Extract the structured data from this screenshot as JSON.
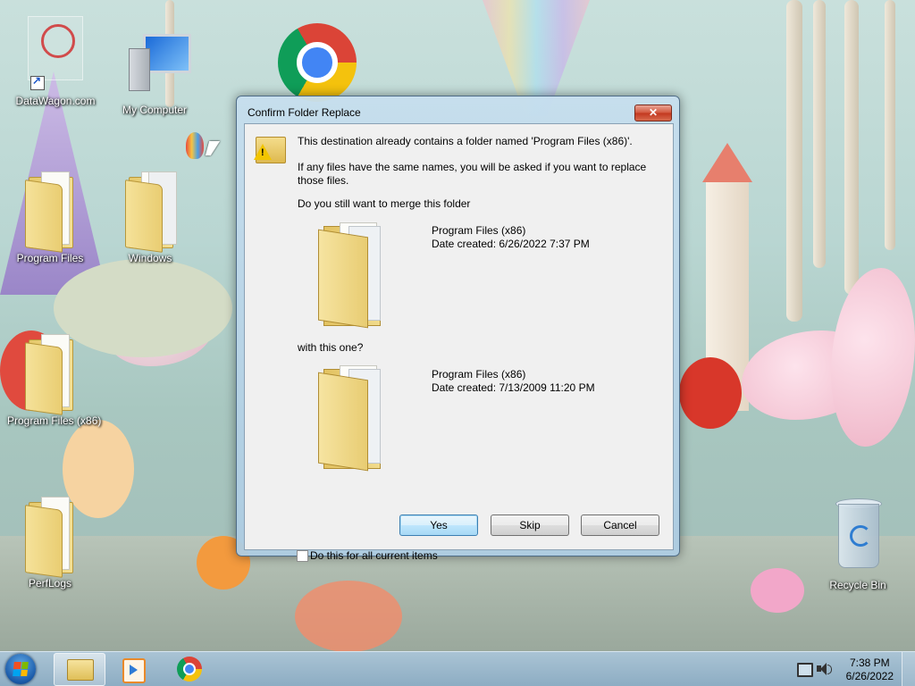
{
  "desktop": {
    "icons": [
      {
        "label": "DataWagon.com"
      },
      {
        "label": "My Computer"
      },
      {
        "label": "Program Files"
      },
      {
        "label": "Windows"
      },
      {
        "label": "Program Files (x86)"
      },
      {
        "label": "PerfLogs"
      },
      {
        "label": "Recycle Bin"
      }
    ]
  },
  "dialog": {
    "title": "Confirm Folder Replace",
    "close_glyph": "✕",
    "message": "This destination already contains a folder named 'Program Files (x86)'.",
    "detail": "If any files have the same names, you will be asked if you want to replace those files.",
    "question": "Do you still want to merge this folder",
    "source": {
      "name": "Program Files (x86)",
      "date": "Date created: 6/26/2022 7:37 PM"
    },
    "with_label": "with this one?",
    "target": {
      "name": "Program Files (x86)",
      "date": "Date created: 7/13/2009 11:20 PM"
    },
    "buttons": {
      "yes": "Yes",
      "skip": "Skip",
      "cancel": "Cancel"
    },
    "checkbox_label": "Do this for all current items",
    "checkbox_checked": false
  },
  "taskbar": {
    "pinned": [
      "folder-icon",
      "media-player-icon",
      "chrome-icon"
    ],
    "time": "7:38 PM",
    "date": "6/26/2022",
    "tray_icons": [
      "network-icon",
      "volume-icon"
    ]
  },
  "colors": {
    "start_flag": [
      "#f25022",
      "#7fba00",
      "#00a4ef",
      "#ffb900"
    ]
  }
}
